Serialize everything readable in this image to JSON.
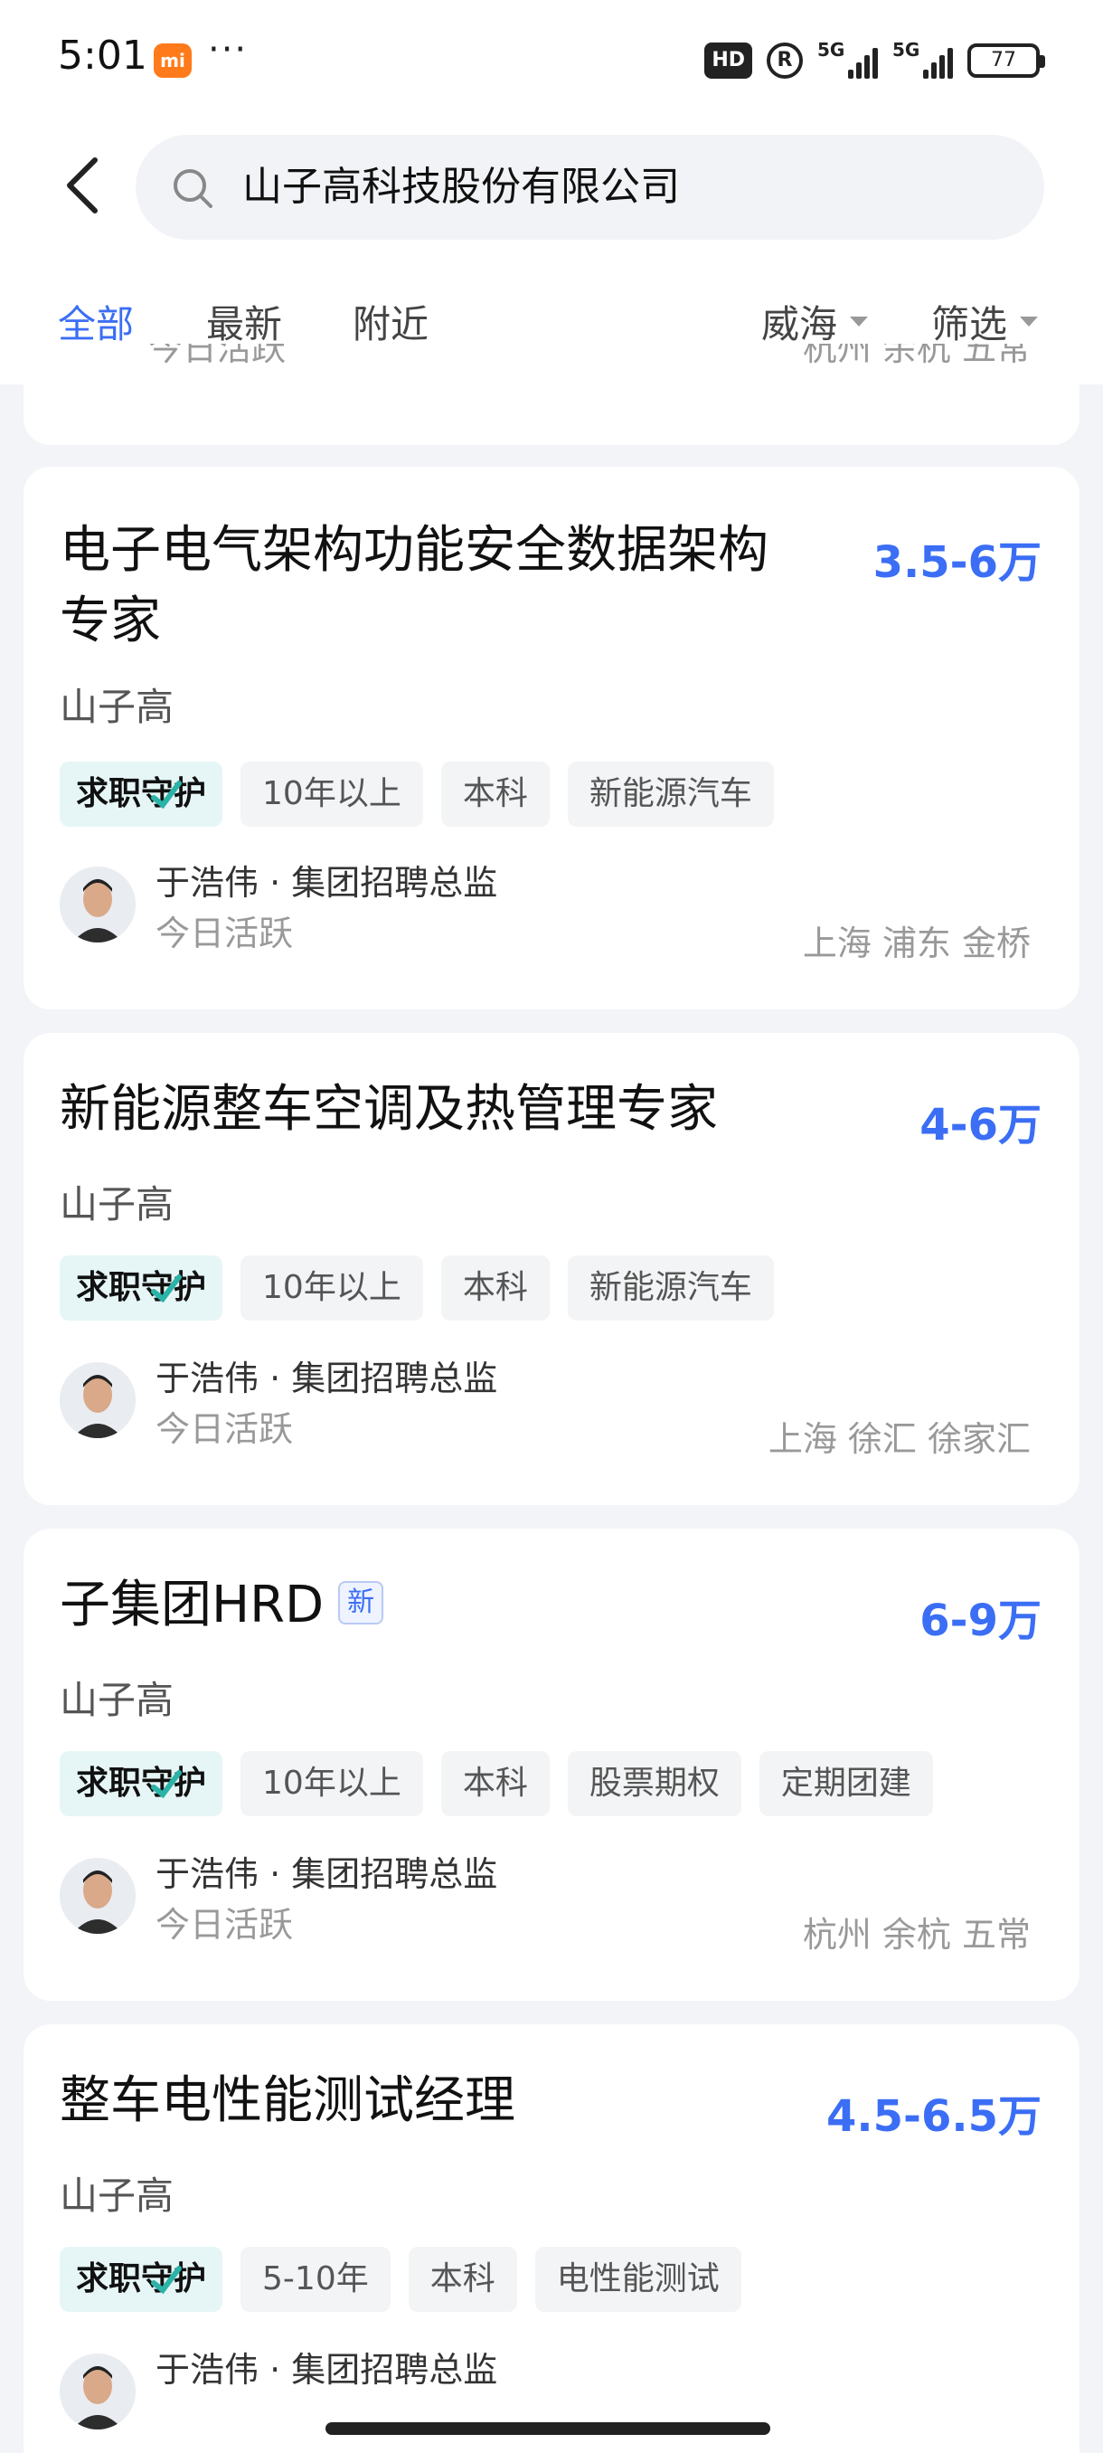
{
  "status_bar": {
    "time": "5:01",
    "mi_label": "mi",
    "dots": "···",
    "hd_label": "HD",
    "r_label": "R",
    "network1": "5G",
    "network2": "5G",
    "battery": "77"
  },
  "search": {
    "query": "山子高科技股份有限公司"
  },
  "tabs": [
    {
      "label": "全部",
      "active": true
    },
    {
      "label": "最新",
      "active": false
    },
    {
      "label": "附近",
      "active": false
    }
  ],
  "filters": {
    "city": "威海",
    "filter": "筛选"
  },
  "partial_card": {
    "left_text": "今日活跃",
    "right_text": "杭州 余杭 五常"
  },
  "jobs": [
    {
      "title_line1": "电子电气架构功能安全数据架构",
      "title_line2": "专家",
      "salary": "3.5-6万",
      "company": "山子高",
      "tags": [
        "求职守护",
        "10年以上",
        "本科",
        "新能源汽车"
      ],
      "recruiter": "于浩伟 · 集团招聘总监",
      "active": "今日活跃",
      "location": "上海 浦东 金桥"
    },
    {
      "title_line1": "新能源整车空调及热管理专家",
      "salary": "4-6万",
      "company": "山子高",
      "tags": [
        "求职守护",
        "10年以上",
        "本科",
        "新能源汽车"
      ],
      "recruiter": "于浩伟 · 集团招聘总监",
      "active": "今日活跃",
      "location": "上海 徐汇 徐家汇"
    },
    {
      "title_line1": "子集团HRD",
      "new_badge": "新",
      "salary": "6-9万",
      "company": "山子高",
      "tags": [
        "求职守护",
        "10年以上",
        "本科",
        "股票期权",
        "定期团建"
      ],
      "recruiter": "于浩伟 · 集团招聘总监",
      "active": "今日活跃",
      "location": "杭州 余杭 五常"
    },
    {
      "title_line1": "整车电性能测试经理",
      "salary": "4.5-6.5万",
      "company": "山子高",
      "tags": [
        "求职守护",
        "5-10年",
        "本科",
        "电性能测试"
      ],
      "recruiter": "于浩伟 · 集团招聘总监"
    }
  ]
}
